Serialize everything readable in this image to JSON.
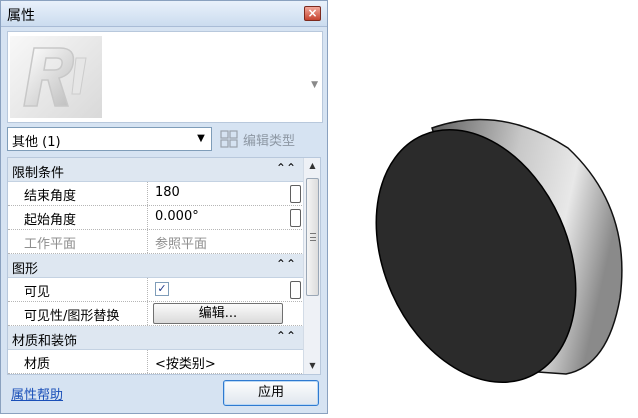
{
  "window": {
    "title": "属性",
    "close_glyph": "×"
  },
  "type_selector": {
    "selected": "其他 (1)",
    "arrow_glyph": "▼",
    "edit_type_label": "编辑类型"
  },
  "groups": [
    {
      "label": "限制条件",
      "collapse_glyph": "⌃⌃",
      "rows": [
        {
          "name": "结束角度",
          "value": "180"
        },
        {
          "name": "起始角度",
          "value": "0.000°"
        },
        {
          "name": "工作平面",
          "value": "参照平面"
        }
      ]
    },
    {
      "label": "图形",
      "collapse_glyph": "⌃⌃",
      "rows": [
        {
          "name": "可见",
          "check_glyph": "✓"
        },
        {
          "name": "可见性/图形替换",
          "button_label": "编辑..."
        }
      ]
    },
    {
      "label": "材质和装饰",
      "collapse_glyph": "⌃⌃",
      "rows": [
        {
          "name": "材质",
          "value": "<按类别>"
        }
      ]
    }
  ],
  "scrollbar": {
    "up_glyph": "▲",
    "down_glyph": "▼"
  },
  "footer": {
    "help_link": "属性帮助",
    "apply_label": "应用"
  },
  "colors": {
    "panel_bg": "#d6e3f2",
    "group_bg": "#dee7f1",
    "link": "#1a4fb8",
    "shape_face": "#2b2b2b",
    "shape_shell": "#9a9a9a"
  }
}
